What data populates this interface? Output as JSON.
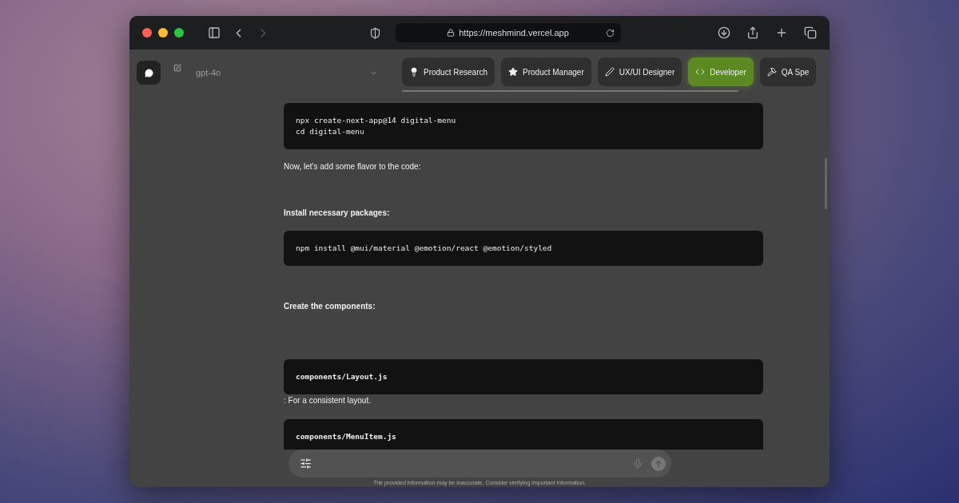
{
  "browser": {
    "url": "https://meshmind.vercel.app",
    "nav_buttons": [
      {
        "kind": "back",
        "disabled": false
      },
      {
        "kind": "forward",
        "disabled": true
      }
    ]
  },
  "toolbar": {
    "model": "gpt-4o"
  },
  "roles": [
    {
      "label": "Product Research",
      "selected": false
    },
    {
      "label": "Product Manager",
      "selected": false
    },
    {
      "label": "UX/UI Designer",
      "selected": false
    },
    {
      "label": "Developer",
      "selected": true
    },
    {
      "label": "QA Spe",
      "selected": false
    }
  ],
  "messages": [
    {
      "kind": "code",
      "lines": [
        "npx create-next-app@14 digital-menu",
        "cd digital-menu"
      ]
    },
    {
      "kind": "text",
      "text": "Now, let's add some flavor to the code:"
    },
    {
      "kind": "heading",
      "text": "Install necessary packages:"
    },
    {
      "kind": "code",
      "lines": [
        "npm install @mui/material @emotion/react @emotion/styled"
      ]
    },
    {
      "kind": "heading",
      "text": "Create the components:"
    },
    {
      "kind": "file",
      "lines": [
        "components/Layout.js"
      ]
    },
    {
      "kind": "text",
      "text": ": For a consistent layout."
    },
    {
      "kind": "file",
      "lines": [
        "components/MenuItem.js"
      ]
    }
  ],
  "disclaimer": "The provided information may be inaccurate. Consider verifying important information."
}
